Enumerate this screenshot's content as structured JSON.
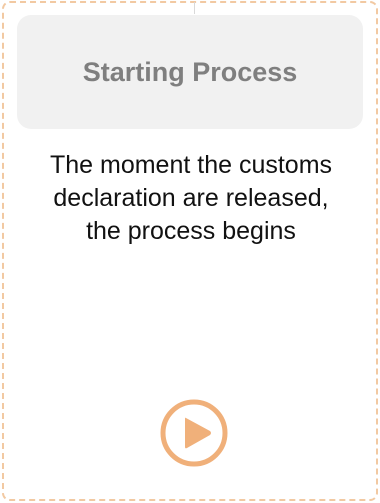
{
  "card": {
    "title": "Starting Process",
    "description": "The moment the customs declaration are released, the process begins",
    "icon": "play-circle-icon"
  },
  "colors": {
    "border": "#f2c9a2",
    "header_bg": "#f1f1f1",
    "title": "#7f7f7f",
    "icon": "#f0b07a"
  }
}
